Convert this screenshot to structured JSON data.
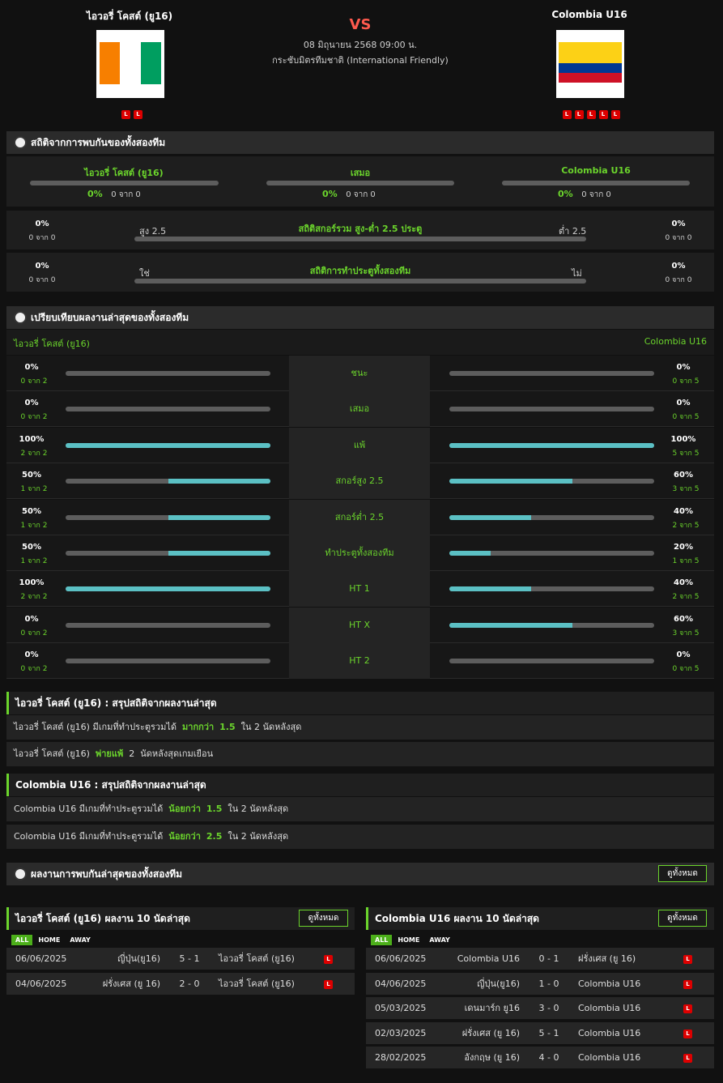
{
  "header": {
    "home_team": "ไอวอรี่ โคสต์ (ยู16)",
    "away_team": "Colombia U16",
    "vs": "VS",
    "date": "08 มิถุนายน 2568 09:00 น.",
    "competition": "กระชับมิตรทีมชาติ (International Friendly)",
    "home_form": [
      "L",
      "L"
    ],
    "away_form": [
      "L",
      "L",
      "L",
      "L",
      "L"
    ]
  },
  "h2h_stats": {
    "title": "สถิติจากการพบกันของทั้งสองทีม",
    "cols": [
      {
        "label": "ไอวอรี่ โคสต์ (ยู16)",
        "pct": "0%",
        "sub": "0 จาก 0"
      },
      {
        "label": "เสมอ",
        "pct": "0%",
        "sub": "0 จาก 0"
      },
      {
        "label": "Colombia U16",
        "pct": "0%",
        "sub": "0 จาก 0"
      }
    ],
    "ou": {
      "title": "สถิติสกอร์รวม สูง-ต่ำ 2.5 ประตู",
      "left_label": "สูง 2.5",
      "right_label": "ต่ำ 2.5",
      "left_pct": "0%",
      "left_sub": "0 จาก 0",
      "right_pct": "0%",
      "right_sub": "0 จาก 0"
    },
    "btts": {
      "title": "สถิติการทำประตูทั้งสองทีม",
      "left_label": "ใช่",
      "right_label": "ไม่",
      "left_pct": "0%",
      "left_sub": "0 จาก 0",
      "right_pct": "0%",
      "right_sub": "0 จาก 0"
    }
  },
  "compare": {
    "title": "เปรียบเทียบผลงานล่าสุดของทั้งสองทีม",
    "home": "ไอวอรี่ โคสต์ (ยู16)",
    "away": "Colombia U16",
    "rows": [
      {
        "label": "ชนะ",
        "l_pct": "0%",
        "l_sub": "0 จาก 2",
        "l_fill": 0,
        "r_pct": "0%",
        "r_sub": "0 จาก 5",
        "r_fill": 0
      },
      {
        "label": "เสมอ",
        "l_pct": "0%",
        "l_sub": "0 จาก 2",
        "l_fill": 0,
        "r_pct": "0%",
        "r_sub": "0 จาก 5",
        "r_fill": 0
      },
      {
        "label": "แพ้",
        "l_pct": "100%",
        "l_sub": "2 จาก 2",
        "l_fill": 100,
        "r_pct": "100%",
        "r_sub": "5 จาก 5",
        "r_fill": 100
      },
      {
        "label": "สกอร์สูง 2.5",
        "l_pct": "50%",
        "l_sub": "1 จาก 2",
        "l_fill": 50,
        "r_pct": "60%",
        "r_sub": "3 จาก 5",
        "r_fill": 60
      },
      {
        "label": "สกอร์ต่ำ 2.5",
        "l_pct": "50%",
        "l_sub": "1 จาก 2",
        "l_fill": 50,
        "r_pct": "40%",
        "r_sub": "2 จาก 5",
        "r_fill": 40
      },
      {
        "label": "ทำประตูทั้งสองทีม",
        "l_pct": "50%",
        "l_sub": "1 จาก 2",
        "l_fill": 50,
        "r_pct": "20%",
        "r_sub": "1 จาก 5",
        "r_fill": 20
      },
      {
        "label": "HT 1",
        "l_pct": "100%",
        "l_sub": "2 จาก 2",
        "l_fill": 100,
        "r_pct": "40%",
        "r_sub": "2 จาก 5",
        "r_fill": 40
      },
      {
        "label": "HT X",
        "l_pct": "0%",
        "l_sub": "0 จาก 2",
        "l_fill": 0,
        "r_pct": "60%",
        "r_sub": "3 จาก 5",
        "r_fill": 60
      },
      {
        "label": "HT 2",
        "l_pct": "0%",
        "l_sub": "0 จาก 2",
        "l_fill": 0,
        "r_pct": "0%",
        "r_sub": "0 จาก 5",
        "r_fill": 0
      }
    ]
  },
  "summary_home": {
    "title": "ไอวอรี่ โคสต์ (ยู16) : สรุปสถิติจากผลงานล่าสุด",
    "r1": {
      "a": "ไอวอรี่ โคสต์ (ยู16)  มีเกมที่ทำประตูรวมได้",
      "b": "มากกว่า",
      "c": "1.5",
      "d": "ใน 2 นัดหลังสุด"
    },
    "r2": {
      "a": "ไอวอรี่ โคสต์ (ยู16)",
      "b": "พ่ายแพ้",
      "c": "2",
      "d": "นัดหลังสุดเกมเยือน"
    }
  },
  "summary_away": {
    "title": "Colombia U16 : สรุปสถิติจากผลงานล่าสุด",
    "r1": {
      "a": "Colombia U16  มีเกมที่ทำประตูรวมได้",
      "b": "น้อยกว่า",
      "c": "1.5",
      "d": "ใน 2 นัดหลังสุด"
    },
    "r2": {
      "a": "Colombia U16  มีเกมที่ทำประตูรวมได้",
      "b": "น้อยกว่า",
      "c": "2.5",
      "d": "ใน 2 นัดหลังสุด"
    }
  },
  "recent": {
    "title": "ผลงานการพบกันล่าสุดของทั้งสองทีม",
    "view_all": "ดูทั้งหมด"
  },
  "home_last10": {
    "title": "ไอวอรี่ โคสต์ (ยู16) ผลงาน 10 นัดล่าสุด",
    "view_all": "ดูทั้งหมด",
    "tabs": [
      "ALL",
      "HOME",
      "AWAY"
    ],
    "matches": [
      {
        "date": "06/06/2025",
        "home": "ญี่ปุ่น(ยู16)",
        "score": "5 - 1",
        "away": "ไอวอรี่ โคสต์ (ยู16)",
        "res": "L"
      },
      {
        "date": "04/06/2025",
        "home": "ฝรั่งเศส (ยู 16)",
        "score": "2 - 0",
        "away": "ไอวอรี่ โคสต์ (ยู16)",
        "res": "L"
      }
    ]
  },
  "away_last10": {
    "title": "Colombia U16 ผลงาน 10 นัดล่าสุด",
    "view_all": "ดูทั้งหมด",
    "tabs": [
      "ALL",
      "HOME",
      "AWAY"
    ],
    "matches": [
      {
        "date": "06/06/2025",
        "home": "Colombia U16",
        "score": "0 - 1",
        "away": "ฝรั่งเศส (ยู 16)",
        "res": "L"
      },
      {
        "date": "04/06/2025",
        "home": "ญี่ปุ่น(ยู16)",
        "score": "1 - 0",
        "away": "Colombia U16",
        "res": "L"
      },
      {
        "date": "05/03/2025",
        "home": "เดนมาร์ก ยู16",
        "score": "3 - 0",
        "away": "Colombia U16",
        "res": "L"
      },
      {
        "date": "02/03/2025",
        "home": "ฝรั่งเศส (ยู 16)",
        "score": "5 - 1",
        "away": "Colombia U16",
        "res": "L"
      },
      {
        "date": "28/02/2025",
        "home": "อังกฤษ (ยู 16)",
        "score": "4 - 0",
        "away": "Colombia U16",
        "res": "L"
      }
    ]
  },
  "colors": {
    "accent": "#6bd42c",
    "bar_fill": "#5bc0c4",
    "loss": "#dd0000"
  }
}
